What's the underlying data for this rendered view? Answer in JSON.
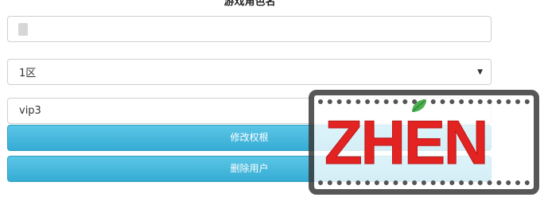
{
  "form": {
    "title": "游戏角色名",
    "character_name_value": "",
    "server_select_value": "1区",
    "vip_value": "vip3",
    "edit_button_label": "修改权根",
    "delete_button_label": "删除用户"
  },
  "watermark": {
    "text": "ZHEN"
  },
  "icons": {
    "select_arrow": "triangle-down-icon",
    "stamp_leaf": "leaf-icon"
  },
  "colors": {
    "button_top": "#5cc6e6",
    "button_bottom": "#35acd4",
    "stamp_red": "#e32222",
    "leaf_green": "#4caf50"
  }
}
